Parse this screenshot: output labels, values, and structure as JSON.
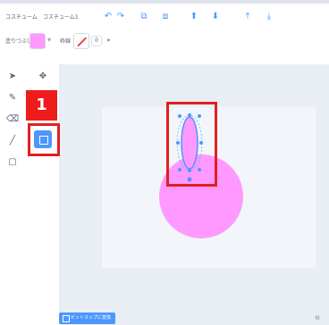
{
  "menu": {
    "costume_label": "コスチューム",
    "costume_name": "コスチューム1",
    "undo_icon": "undo-icon",
    "redo_icon": "redo-icon",
    "group_icon": "group-icon",
    "ungroup_icon": "ungroup-icon",
    "forward_icon": "forward-icon",
    "backward_icon": "backward-icon",
    "front_icon": "front-icon",
    "back_icon": "back-icon"
  },
  "fill": {
    "label": "塗りつぶし",
    "color": "#ff99ff"
  },
  "outline": {
    "label": "枠線",
    "width": "0"
  },
  "tools": [
    {
      "name": "select-tool",
      "icon": "arrow-icon"
    },
    {
      "name": "reshape-tool",
      "icon": "reshape-icon"
    },
    {
      "name": "brush-tool",
      "icon": "brush-icon"
    },
    {
      "name": "eraser-tool",
      "icon": "eraser-icon"
    },
    {
      "name": "line-tool",
      "icon": "line-icon"
    },
    {
      "name": "circle-tool",
      "icon": "circle-icon",
      "selected": true
    },
    {
      "name": "rectangle-tool",
      "icon": "rectangle-icon"
    }
  ],
  "callout": {
    "number": "1"
  },
  "canvas": {
    "shape_color": "#ff99ff",
    "selection_color": "#4c97ff"
  },
  "bottom": {
    "convert_label": "ビットマップに変換",
    "zoom_icon": "zoom-icon"
  }
}
